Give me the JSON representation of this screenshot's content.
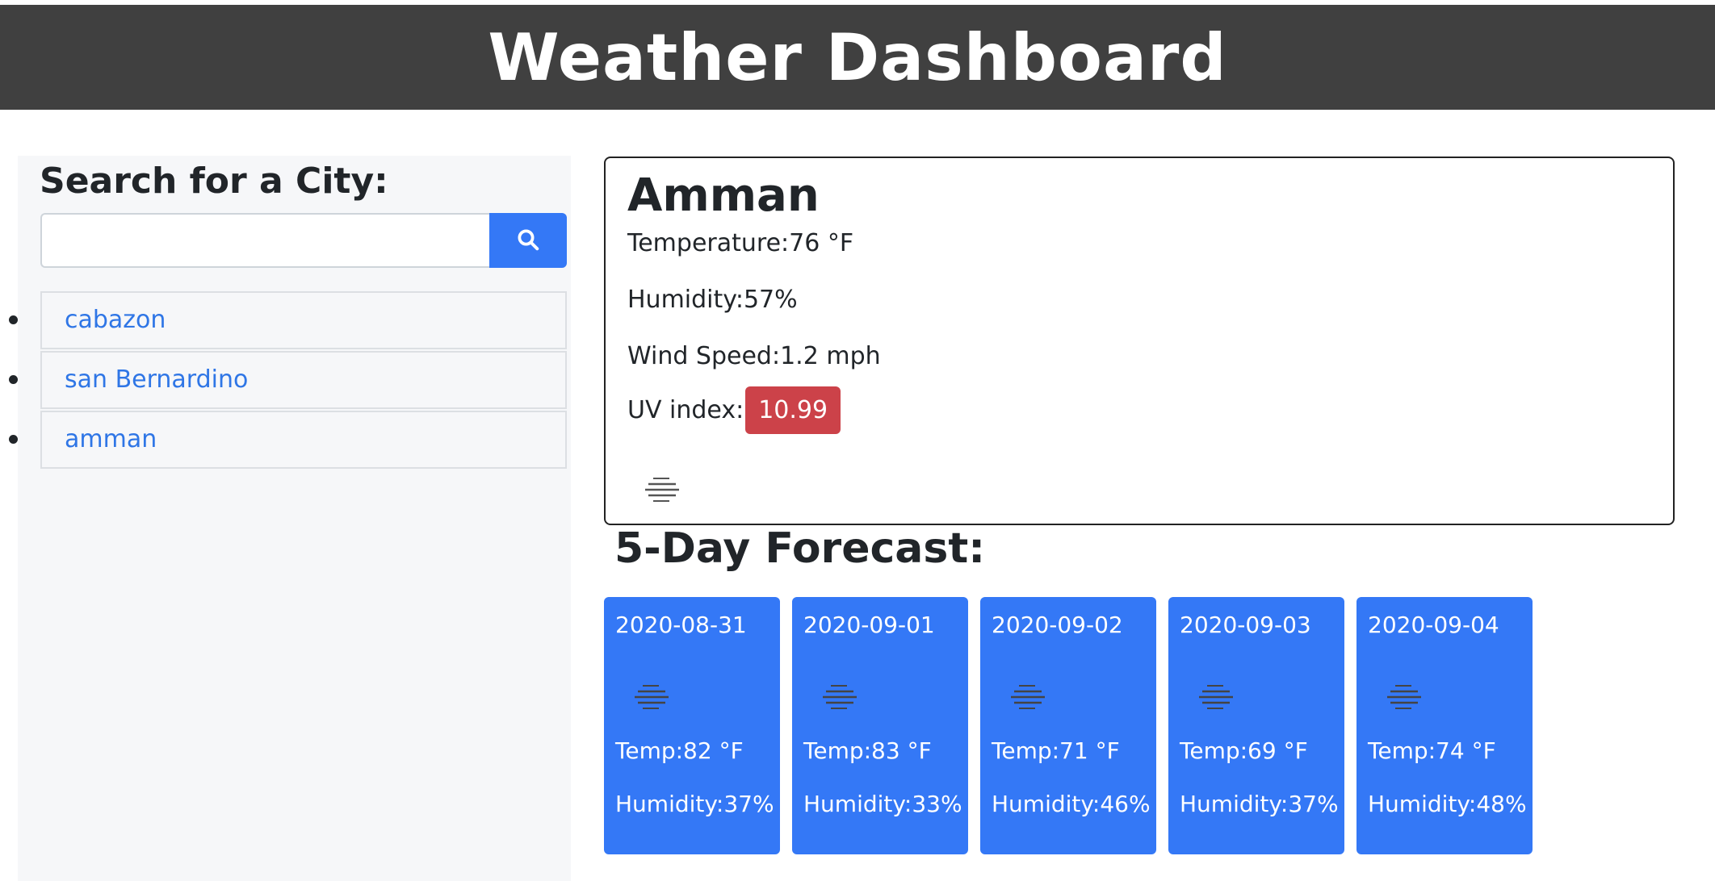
{
  "header": {
    "title": "Weather Dashboard"
  },
  "sidebar": {
    "heading": "Search for a City:",
    "search": {
      "value": "",
      "placeholder": ""
    },
    "cities": [
      {
        "label": "cabazon"
      },
      {
        "label": "san Bernardino"
      },
      {
        "label": "amman"
      }
    ]
  },
  "current": {
    "city": "Amman",
    "temperature_label": "Temperature:",
    "temperature_value": "76 °F",
    "humidity_label": "Humidity:",
    "humidity_value": "57%",
    "wind_label": "Wind Speed:",
    "wind_value": "1.2 mph",
    "uv_label": "UV index:",
    "uv_value": "10.99",
    "icon": "mist-icon"
  },
  "forecast": {
    "title": "5-Day Forecast:",
    "days": [
      {
        "date": "2020-08-31",
        "temp": "Temp:82 °F",
        "humidity": "Humidity:37%",
        "icon": "mist-icon"
      },
      {
        "date": "2020-09-01",
        "temp": "Temp:83 °F",
        "humidity": "Humidity:33%",
        "icon": "mist-icon"
      },
      {
        "date": "2020-09-02",
        "temp": "Temp:71 °F",
        "humidity": "Humidity:46%",
        "icon": "mist-icon"
      },
      {
        "date": "2020-09-03",
        "temp": "Temp:69 °F",
        "humidity": "Humidity:37%",
        "icon": "mist-icon"
      },
      {
        "date": "2020-09-04",
        "temp": "Temp:74 °F",
        "humidity": "Humidity:48%",
        "icon": "mist-icon"
      }
    ]
  },
  "colors": {
    "header_bg": "#404040",
    "accent": "#3478f6",
    "link": "#2f76e6",
    "uv_danger": "#cc4249",
    "sidebar_bg": "#f6f7f9"
  }
}
